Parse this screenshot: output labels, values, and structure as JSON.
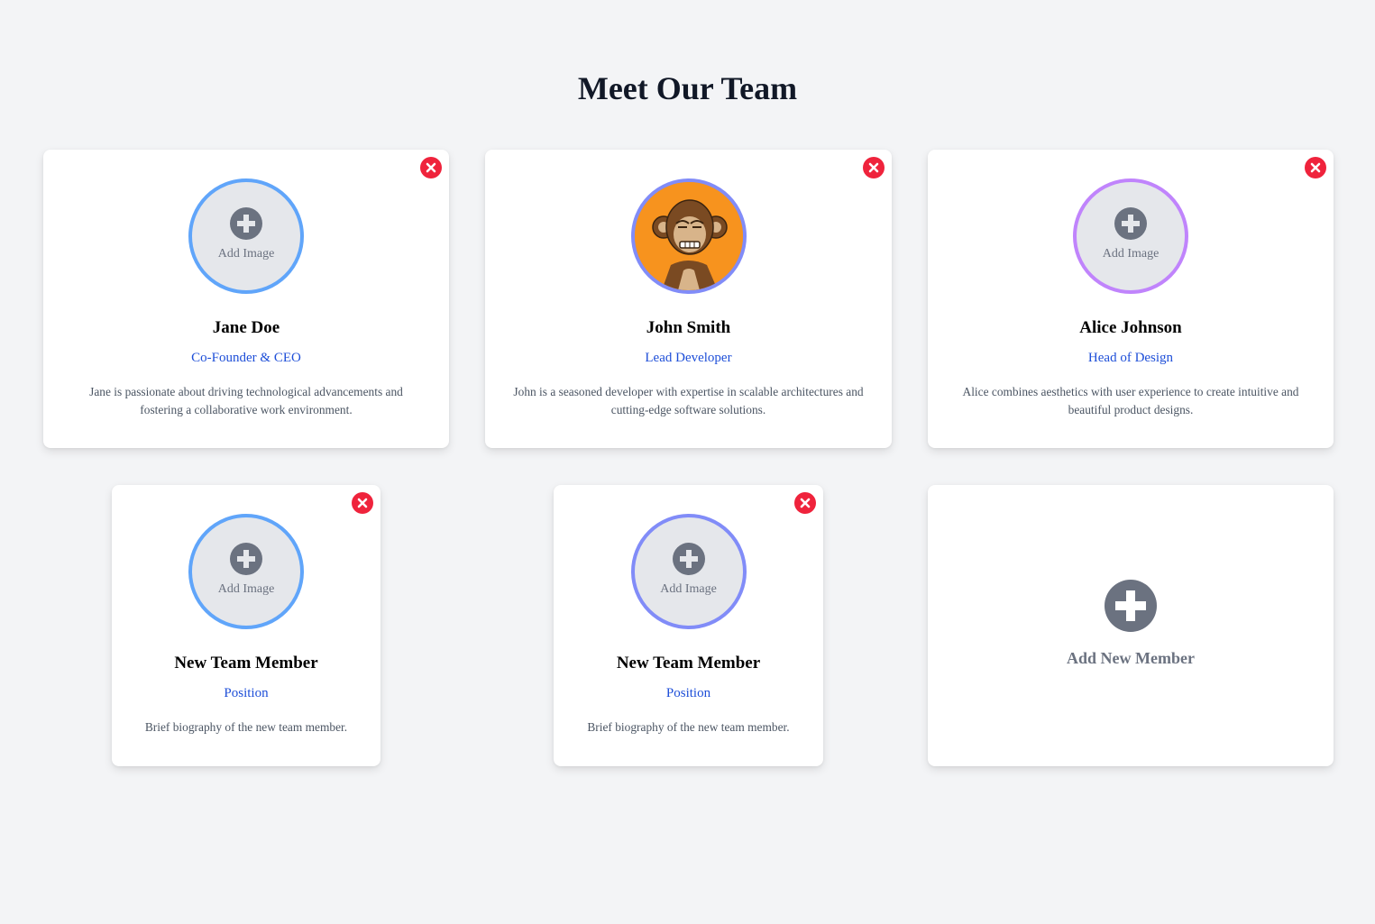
{
  "page": {
    "title": "Meet Our Team"
  },
  "labels": {
    "add_image": "Add Image",
    "add_new_member": "Add New Member"
  },
  "colors": {
    "background": "#f3f4f6",
    "remove": "#ef233c",
    "role": "#1d4ed8",
    "ring_blue": "#60a5fa",
    "ring_indigo": "#818cf8",
    "ring_purple": "#c084fc",
    "icon_gray": "#6b7280"
  },
  "members": [
    {
      "name": "Jane Doe",
      "role": "Co-Founder & CEO",
      "bio": "Jane is passionate about driving technological advancements and fostering a collaborative work environment.",
      "has_image": false,
      "ring_color": "#60a5fa"
    },
    {
      "name": "John Smith",
      "role": "Lead Developer",
      "bio": "John is a seasoned developer with expertise in scalable architectures and cutting-edge software solutions.",
      "has_image": true,
      "image_icon": "ape-avatar",
      "ring_color": "#818cf8"
    },
    {
      "name": "Alice Johnson",
      "role": "Head of Design",
      "bio": "Alice combines aesthetics with user experience to create intuitive and beautiful product designs.",
      "has_image": false,
      "ring_color": "#c084fc"
    },
    {
      "name": "New Team Member",
      "role": "Position",
      "bio": "Brief biography of the new team member.",
      "has_image": false,
      "ring_color": "#60a5fa"
    },
    {
      "name": "New Team Member",
      "role": "Position",
      "bio": "Brief biography of the new team member.",
      "has_image": false,
      "ring_color": "#818cf8"
    }
  ]
}
